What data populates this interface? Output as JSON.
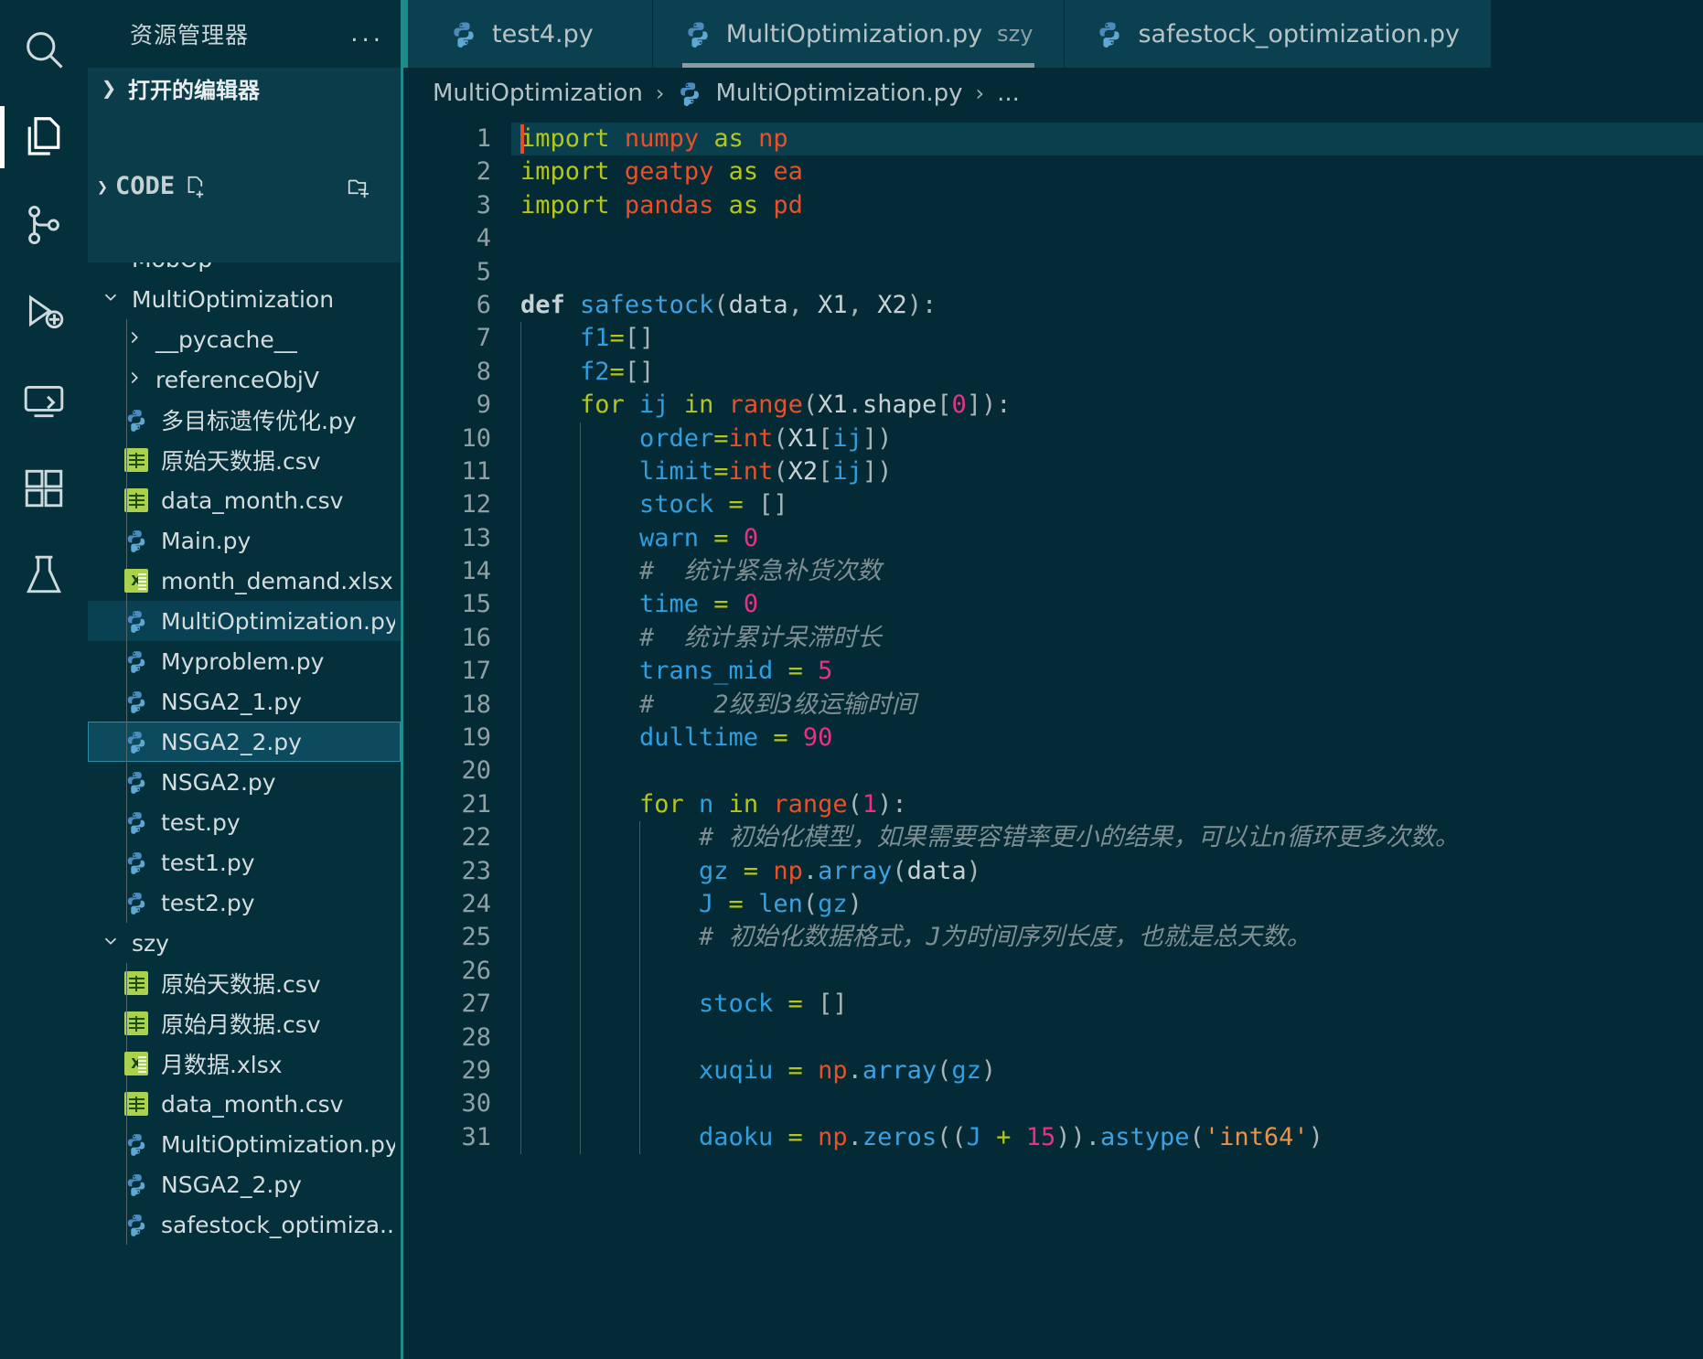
{
  "activity_bar": {
    "items": [
      {
        "name": "search-icon",
        "label": "Search",
        "active": false
      },
      {
        "name": "explorer-icon",
        "label": "Explorer",
        "active": true
      },
      {
        "name": "source-control-icon",
        "label": "Source Control",
        "active": false
      },
      {
        "name": "run-debug-icon",
        "label": "Run and Debug",
        "active": false
      },
      {
        "name": "remote-explorer-icon",
        "label": "Remote Explorer",
        "active": false
      },
      {
        "name": "extensions-icon",
        "label": "Extensions",
        "active": false
      },
      {
        "name": "testing-icon",
        "label": "Testing",
        "active": false
      }
    ]
  },
  "sidebar": {
    "title": "资源管理器",
    "more_actions": "...",
    "open_editors_label": "打开的编辑器",
    "workspace_label": "CODE",
    "actions": [
      "new-file",
      "new-folder",
      "refresh",
      "collapse-all"
    ],
    "tree": [
      {
        "label": "MobOp",
        "type": "folder",
        "depth": 1,
        "expanded": false,
        "clipped": true
      },
      {
        "label": "MultiOptimization",
        "type": "folder",
        "depth": 1,
        "expanded": true
      },
      {
        "label": "__pycache__",
        "type": "folder",
        "depth": 2,
        "expanded": false
      },
      {
        "label": "referenceObjV",
        "type": "folder",
        "depth": 2,
        "expanded": false
      },
      {
        "label": "多目标遗传优化.py",
        "type": "py",
        "depth": 2
      },
      {
        "label": "原始天数据.csv",
        "type": "csv",
        "depth": 2
      },
      {
        "label": "data_month.csv",
        "type": "csv",
        "depth": 2
      },
      {
        "label": "Main.py",
        "type": "py",
        "depth": 2
      },
      {
        "label": "month_demand.xlsx",
        "type": "xlsx",
        "depth": 2
      },
      {
        "label": "MultiOptimization.py",
        "type": "py",
        "depth": 2,
        "state": "sel-light"
      },
      {
        "label": "Myproblem.py",
        "type": "py",
        "depth": 2
      },
      {
        "label": "NSGA2_1.py",
        "type": "py",
        "depth": 2
      },
      {
        "label": "NSGA2_2.py",
        "type": "py",
        "depth": 2,
        "state": "sel-focus"
      },
      {
        "label": "NSGA2.py",
        "type": "py",
        "depth": 2
      },
      {
        "label": "test.py",
        "type": "py",
        "depth": 2
      },
      {
        "label": "test1.py",
        "type": "py",
        "depth": 2
      },
      {
        "label": "test2.py",
        "type": "py",
        "depth": 2
      },
      {
        "label": "szy",
        "type": "folder",
        "depth": 1,
        "expanded": true
      },
      {
        "label": "原始天数据.csv",
        "type": "csv",
        "depth": 2
      },
      {
        "label": "原始月数据.csv",
        "type": "csv",
        "depth": 2
      },
      {
        "label": "月数据.xlsx",
        "type": "xlsx",
        "depth": 2
      },
      {
        "label": "data_month.csv",
        "type": "csv",
        "depth": 2
      },
      {
        "label": "MultiOptimization.py",
        "type": "py",
        "depth": 2
      },
      {
        "label": "NSGA2_2.py",
        "type": "py",
        "depth": 2
      },
      {
        "label": "safestock_optimiza...",
        "type": "py",
        "depth": 2
      }
    ]
  },
  "editor": {
    "tabs": [
      {
        "label": "test4.py",
        "suffix": "",
        "active": false
      },
      {
        "label": "MultiOptimization.py",
        "suffix": "szy",
        "active": true
      },
      {
        "label": "safestock_optimization.py",
        "suffix": "",
        "active": false
      }
    ],
    "breadcrumb": [
      "MultiOptimization",
      "MultiOptimization.py",
      "..."
    ],
    "line_numbers": [
      1,
      2,
      3,
      4,
      5,
      6,
      7,
      8,
      9,
      10,
      11,
      12,
      13,
      14,
      15,
      16,
      17,
      18,
      19,
      20,
      21,
      22,
      23,
      24,
      25,
      26,
      27,
      28,
      29,
      30,
      31
    ],
    "current_line": 1,
    "code_lines": [
      {
        "n": 1,
        "indent": 0,
        "guides": 0,
        "tokens": [
          {
            "t": "import",
            "c": "kw"
          },
          {
            "t": " ",
            "c": "plain"
          },
          {
            "t": "numpy",
            "c": "mod"
          },
          {
            "t": " ",
            "c": "plain"
          },
          {
            "t": "as",
            "c": "kw"
          },
          {
            "t": " ",
            "c": "plain"
          },
          {
            "t": "np",
            "c": "mod"
          }
        ]
      },
      {
        "n": 2,
        "indent": 0,
        "guides": 0,
        "tokens": [
          {
            "t": "import",
            "c": "kw"
          },
          {
            "t": " ",
            "c": "plain"
          },
          {
            "t": "geatpy",
            "c": "mod"
          },
          {
            "t": " ",
            "c": "plain"
          },
          {
            "t": "as",
            "c": "kw"
          },
          {
            "t": " ",
            "c": "plain"
          },
          {
            "t": "ea",
            "c": "mod"
          }
        ]
      },
      {
        "n": 3,
        "indent": 0,
        "guides": 0,
        "tokens": [
          {
            "t": "import",
            "c": "kw"
          },
          {
            "t": " ",
            "c": "plain"
          },
          {
            "t": "pandas",
            "c": "mod"
          },
          {
            "t": " ",
            "c": "plain"
          },
          {
            "t": "as",
            "c": "kw"
          },
          {
            "t": " ",
            "c": "plain"
          },
          {
            "t": "pd",
            "c": "mod"
          }
        ]
      },
      {
        "n": 4,
        "indent": 0,
        "guides": 0,
        "tokens": []
      },
      {
        "n": 5,
        "indent": 0,
        "guides": 0,
        "tokens": []
      },
      {
        "n": 6,
        "indent": 0,
        "guides": 0,
        "tokens": [
          {
            "t": "def",
            "c": "def"
          },
          {
            "t": " ",
            "c": "plain"
          },
          {
            "t": "safestock",
            "c": "fn"
          },
          {
            "t": "(",
            "c": "punct"
          },
          {
            "t": "data",
            "c": "plain"
          },
          {
            "t": ", ",
            "c": "punct"
          },
          {
            "t": "X1",
            "c": "plain"
          },
          {
            "t": ", ",
            "c": "punct"
          },
          {
            "t": "X2",
            "c": "plain"
          },
          {
            "t": "):",
            "c": "punct"
          }
        ]
      },
      {
        "n": 7,
        "indent": 1,
        "guides": 1,
        "tokens": [
          {
            "t": "f1",
            "c": "var"
          },
          {
            "t": "=",
            "c": "op"
          },
          {
            "t": "[]",
            "c": "punct"
          }
        ]
      },
      {
        "n": 8,
        "indent": 1,
        "guides": 1,
        "tokens": [
          {
            "t": "f2",
            "c": "var"
          },
          {
            "t": "=",
            "c": "op"
          },
          {
            "t": "[]",
            "c": "punct"
          }
        ]
      },
      {
        "n": 9,
        "indent": 1,
        "guides": 1,
        "tokens": [
          {
            "t": "for",
            "c": "kw"
          },
          {
            "t": " ",
            "c": "plain"
          },
          {
            "t": "ij",
            "c": "var"
          },
          {
            "t": " ",
            "c": "plain"
          },
          {
            "t": "in",
            "c": "kw"
          },
          {
            "t": " ",
            "c": "plain"
          },
          {
            "t": "range",
            "c": "builtin"
          },
          {
            "t": "(",
            "c": "punct"
          },
          {
            "t": "X1",
            "c": "plain"
          },
          {
            "t": ".",
            "c": "punct"
          },
          {
            "t": "shape",
            "c": "plain"
          },
          {
            "t": "[",
            "c": "punct"
          },
          {
            "t": "0",
            "c": "num"
          },
          {
            "t": "]):",
            "c": "punct"
          }
        ]
      },
      {
        "n": 10,
        "indent": 2,
        "guides": 2,
        "tokens": [
          {
            "t": "order",
            "c": "var"
          },
          {
            "t": "=",
            "c": "op"
          },
          {
            "t": "int",
            "c": "builtin"
          },
          {
            "t": "(",
            "c": "punct"
          },
          {
            "t": "X1",
            "c": "plain"
          },
          {
            "t": "[",
            "c": "punct"
          },
          {
            "t": "ij",
            "c": "var"
          },
          {
            "t": "])",
            "c": "punct"
          }
        ]
      },
      {
        "n": 11,
        "indent": 2,
        "guides": 2,
        "tokens": [
          {
            "t": "limit",
            "c": "var"
          },
          {
            "t": "=",
            "c": "op"
          },
          {
            "t": "int",
            "c": "builtin"
          },
          {
            "t": "(",
            "c": "punct"
          },
          {
            "t": "X2",
            "c": "plain"
          },
          {
            "t": "[",
            "c": "punct"
          },
          {
            "t": "ij",
            "c": "var"
          },
          {
            "t": "])",
            "c": "punct"
          }
        ]
      },
      {
        "n": 12,
        "indent": 2,
        "guides": 2,
        "tokens": [
          {
            "t": "stock",
            "c": "var"
          },
          {
            "t": " ",
            "c": "plain"
          },
          {
            "t": "=",
            "c": "op"
          },
          {
            "t": " ",
            "c": "plain"
          },
          {
            "t": "[]",
            "c": "punct"
          }
        ]
      },
      {
        "n": 13,
        "indent": 2,
        "guides": 2,
        "tokens": [
          {
            "t": "warn",
            "c": "var"
          },
          {
            "t": " ",
            "c": "plain"
          },
          {
            "t": "=",
            "c": "op"
          },
          {
            "t": " ",
            "c": "plain"
          },
          {
            "t": "0",
            "c": "num"
          }
        ]
      },
      {
        "n": 14,
        "indent": 2,
        "guides": 2,
        "tokens": [
          {
            "t": "#  统计紧急补货次数",
            "c": "cmt"
          }
        ]
      },
      {
        "n": 15,
        "indent": 2,
        "guides": 2,
        "tokens": [
          {
            "t": "time",
            "c": "var"
          },
          {
            "t": " ",
            "c": "plain"
          },
          {
            "t": "=",
            "c": "op"
          },
          {
            "t": " ",
            "c": "plain"
          },
          {
            "t": "0",
            "c": "num"
          }
        ]
      },
      {
        "n": 16,
        "indent": 2,
        "guides": 2,
        "tokens": [
          {
            "t": "#  统计累计呆滞时长",
            "c": "cmt"
          }
        ]
      },
      {
        "n": 17,
        "indent": 2,
        "guides": 2,
        "tokens": [
          {
            "t": "trans_mid",
            "c": "var"
          },
          {
            "t": " ",
            "c": "plain"
          },
          {
            "t": "=",
            "c": "op"
          },
          {
            "t": " ",
            "c": "plain"
          },
          {
            "t": "5",
            "c": "num"
          }
        ]
      },
      {
        "n": 18,
        "indent": 2,
        "guides": 2,
        "tokens": [
          {
            "t": "#    2级到3级运输时间",
            "c": "cmt"
          }
        ]
      },
      {
        "n": 19,
        "indent": 2,
        "guides": 2,
        "tokens": [
          {
            "t": "dulltime",
            "c": "var"
          },
          {
            "t": " ",
            "c": "plain"
          },
          {
            "t": "=",
            "c": "op"
          },
          {
            "t": " ",
            "c": "plain"
          },
          {
            "t": "90",
            "c": "num"
          }
        ]
      },
      {
        "n": 20,
        "indent": 2,
        "guides": 2,
        "tokens": []
      },
      {
        "n": 21,
        "indent": 2,
        "guides": 2,
        "tokens": [
          {
            "t": "for",
            "c": "kw"
          },
          {
            "t": " ",
            "c": "plain"
          },
          {
            "t": "n",
            "c": "var"
          },
          {
            "t": " ",
            "c": "plain"
          },
          {
            "t": "in",
            "c": "kw"
          },
          {
            "t": " ",
            "c": "plain"
          },
          {
            "t": "range",
            "c": "builtin"
          },
          {
            "t": "(",
            "c": "punct"
          },
          {
            "t": "1",
            "c": "num"
          },
          {
            "t": "):",
            "c": "punct"
          }
        ]
      },
      {
        "n": 22,
        "indent": 3,
        "guides": 3,
        "tokens": [
          {
            "t": "# 初始化模型，如果需要容错率更小的结果，可以让n循环更多次数。",
            "c": "cmt"
          }
        ]
      },
      {
        "n": 23,
        "indent": 3,
        "guides": 3,
        "tokens": [
          {
            "t": "gz",
            "c": "var"
          },
          {
            "t": " ",
            "c": "plain"
          },
          {
            "t": "=",
            "c": "op"
          },
          {
            "t": " ",
            "c": "plain"
          },
          {
            "t": "np",
            "c": "mod"
          },
          {
            "t": ".",
            "c": "punct"
          },
          {
            "t": "array",
            "c": "fn"
          },
          {
            "t": "(",
            "c": "punct"
          },
          {
            "t": "data",
            "c": "plain"
          },
          {
            "t": ")",
            "c": "punct"
          }
        ]
      },
      {
        "n": 24,
        "indent": 3,
        "guides": 3,
        "tokens": [
          {
            "t": "J",
            "c": "var"
          },
          {
            "t": " ",
            "c": "plain"
          },
          {
            "t": "=",
            "c": "op"
          },
          {
            "t": " ",
            "c": "plain"
          },
          {
            "t": "len",
            "c": "fn"
          },
          {
            "t": "(",
            "c": "punct"
          },
          {
            "t": "gz",
            "c": "var"
          },
          {
            "t": ")",
            "c": "punct"
          }
        ]
      },
      {
        "n": 25,
        "indent": 3,
        "guides": 3,
        "tokens": [
          {
            "t": "# 初始化数据格式，J为时间序列长度，也就是总天数。",
            "c": "cmt"
          }
        ]
      },
      {
        "n": 26,
        "indent": 3,
        "guides": 3,
        "tokens": []
      },
      {
        "n": 27,
        "indent": 3,
        "guides": 3,
        "tokens": [
          {
            "t": "stock",
            "c": "var"
          },
          {
            "t": " ",
            "c": "plain"
          },
          {
            "t": "=",
            "c": "op"
          },
          {
            "t": " ",
            "c": "plain"
          },
          {
            "t": "[]",
            "c": "punct"
          }
        ]
      },
      {
        "n": 28,
        "indent": 3,
        "guides": 3,
        "tokens": []
      },
      {
        "n": 29,
        "indent": 3,
        "guides": 3,
        "tokens": [
          {
            "t": "xuqiu",
            "c": "var"
          },
          {
            "t": " ",
            "c": "plain"
          },
          {
            "t": "=",
            "c": "op"
          },
          {
            "t": " ",
            "c": "plain"
          },
          {
            "t": "np",
            "c": "mod"
          },
          {
            "t": ".",
            "c": "punct"
          },
          {
            "t": "array",
            "c": "fn"
          },
          {
            "t": "(",
            "c": "punct"
          },
          {
            "t": "gz",
            "c": "var"
          },
          {
            "t": ")",
            "c": "punct"
          }
        ]
      },
      {
        "n": 30,
        "indent": 3,
        "guides": 3,
        "tokens": []
      },
      {
        "n": 31,
        "indent": 3,
        "guides": 3,
        "tokens": [
          {
            "t": "daoku",
            "c": "var"
          },
          {
            "t": " ",
            "c": "plain"
          },
          {
            "t": "=",
            "c": "op"
          },
          {
            "t": " ",
            "c": "plain"
          },
          {
            "t": "np",
            "c": "mod"
          },
          {
            "t": ".",
            "c": "punct"
          },
          {
            "t": "zeros",
            "c": "fn"
          },
          {
            "t": "((",
            "c": "punct"
          },
          {
            "t": "J",
            "c": "var"
          },
          {
            "t": " + ",
            "c": "op"
          },
          {
            "t": "15",
            "c": "num"
          },
          {
            "t": "))",
            "c": "punct"
          },
          {
            "t": ".",
            "c": "punct"
          },
          {
            "t": "astype",
            "c": "fn"
          },
          {
            "t": "(",
            "c": "punct"
          },
          {
            "t": "'int64'",
            "c": "str"
          },
          {
            "t": ")",
            "c": "punct"
          }
        ]
      }
    ]
  },
  "colors": {
    "background": "#042a35",
    "sidebar_bg": "#04303c",
    "accent_border": "#1f8a8a",
    "tab_active_bg": "#0a4050",
    "selection_bg": "#0c4a5e",
    "keyword": "#b4c61c",
    "module": "#e8502a",
    "variable": "#2f9fe0",
    "number": "#e8308a",
    "comment": "#7d8f93",
    "string": "#e8924a",
    "python_icon": "#4b8bbe",
    "csv_icon": "#a9d14b",
    "caret": "#e84a2a"
  }
}
